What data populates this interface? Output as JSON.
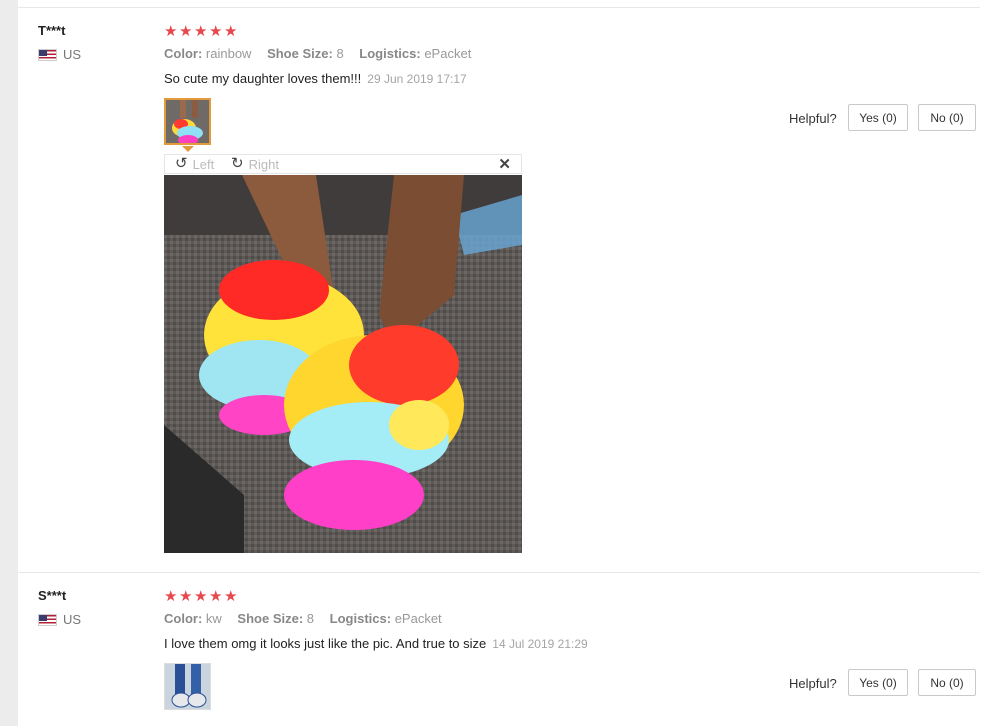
{
  "reviews": [
    {
      "user": "T***t",
      "country": "US",
      "stars": [
        "★",
        "★",
        "★",
        "★",
        "★"
      ],
      "color_label": "Color:",
      "color_value": "rainbow",
      "size_label": "Shoe Size:",
      "size_value": "8",
      "logistics_label": "Logistics:",
      "logistics_value": "ePacket",
      "text": "So cute my daughter loves them!!!",
      "date": "29 Jun 2019 17:17",
      "helpful_label": "Helpful?",
      "yes_label": "Yes (0)",
      "no_label": "No (0)"
    },
    {
      "user": "S***t",
      "country": "US",
      "stars": [
        "★",
        "★",
        "★",
        "★",
        "★"
      ],
      "color_label": "Color:",
      "color_value": "kw",
      "size_label": "Shoe Size:",
      "size_value": "8",
      "logistics_label": "Logistics:",
      "logistics_value": "ePacket",
      "text": "I love them omg it looks just like the pic. And true to size",
      "date": "14 Jul 2019 21:29",
      "helpful_label": "Helpful?",
      "yes_label": "Yes (0)",
      "no_label": "No (0)"
    }
  ],
  "viewer": {
    "rotate_left_label": "Left",
    "rotate_right_label": "Right",
    "rotate_left_icon": "rotate-left-icon",
    "rotate_right_icon": "rotate-right-icon",
    "close_icon": "close-icon"
  },
  "colors": {
    "star": "#e5484d",
    "thumb_active_border": "#e39a3c"
  }
}
